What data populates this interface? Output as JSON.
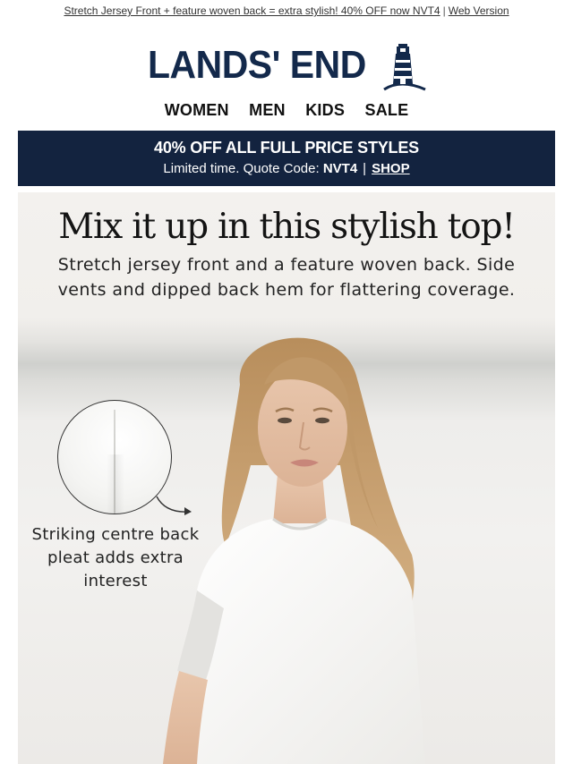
{
  "preheader": {
    "text": "Stretch Jersey Front + feature woven back = extra stylish! 40% OFF now NVT4",
    "separator": "|",
    "web_version": "Web Version"
  },
  "brand": {
    "name": "LANDS' END",
    "color": "#13294b"
  },
  "nav": {
    "items": [
      "WOMEN",
      "MEN",
      "KIDS",
      "SALE"
    ]
  },
  "promo": {
    "title": "40% OFF ALL FULL PRICE STYLES",
    "lead": "Limited time. Quote Code:",
    "code": "NVT4",
    "separator": "|",
    "cta": "SHOP",
    "background": "#13233f"
  },
  "hero": {
    "headline": "Mix it up in this stylish top!",
    "subhead": "Stretch jersey front and a feature woven back. Side vents and dipped back hem for flattering coverage.",
    "detail_caption": "Striking centre back pleat adds extra interest",
    "detail_icon": "pleat-detail-zoom",
    "arrow_icon": "curved-arrow-icon"
  }
}
